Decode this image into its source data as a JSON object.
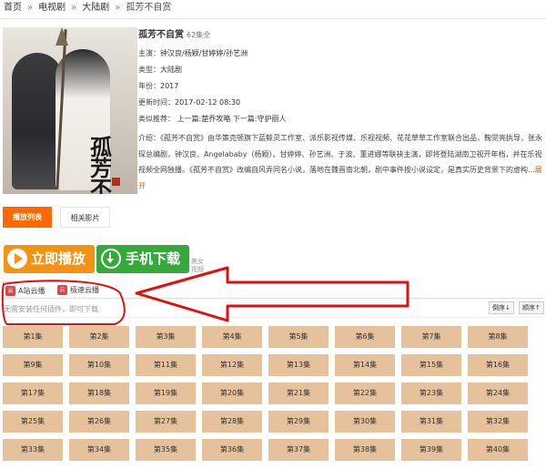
{
  "breadcrumb": {
    "home": "首页",
    "sep": "»",
    "category": "电视剧",
    "subcategory": "大陆剧",
    "current": "孤芳不自赏"
  },
  "poster": {
    "calligraphy": "孤芳不自赏"
  },
  "info": {
    "title": "孤芳不自赏",
    "episodes": "62集全",
    "cast_label": "主演：",
    "cast_value": "钟汉良/杨颖/甘婷婷/孙艺洲",
    "type_label": "类型：",
    "type_value": "大陆剧",
    "year_label": "年份：",
    "year_value": "2017",
    "updated_label": "更新时间：",
    "updated_value": "2017-02-12 08:30",
    "recommend_label": "类似推荐：",
    "prev_label": "上一篇:",
    "prev_link": "楚乔攻略",
    "next_label": "下一篇:",
    "next_link": "守护丽人",
    "intro_label": "介绍：",
    "intro_text": "《孤芳不自赏》由华策克顿旗下蓝鲸灵工作室、派乐影视传媒、乐视视频、花花草草工作室联合出品，鞠觉亮执导，张永琛总编剧，钟汉良、Angelababy（杨颖）、甘婷婷、孙艺洲、于波、董进娜等联袂主演，即将登陆湖南卫视开年档，并在乐视视频全网独播。《孤芳不自赏》改编自风弄同名小说，落地在魏晋南北朝，剧中事件按小说设定，是真实历史背景下的虚构...",
    "more": "展开"
  },
  "tabs": {
    "playlist": "播放列表",
    "related": "相关影片"
  },
  "actions": {
    "play": "立即播放",
    "download": "手机下载",
    "side_ad": "美女视频"
  },
  "sources": {
    "badge": "云",
    "tab1": "A站云播",
    "tab2": "极速云播",
    "note": "无需安装任何插件，即可下载",
    "sort_desc": "倒序↓",
    "sort_asc": "顺序↑"
  },
  "episodes": [
    "第1集",
    "第2集",
    "第3集",
    "第4集",
    "第5集",
    "第6集",
    "第7集",
    "第8集",
    "第9集",
    "第10集",
    "第11集",
    "第12集",
    "第13集",
    "第14集",
    "第15集",
    "第16集",
    "第17集",
    "第18集",
    "第19集",
    "第20集",
    "第21集",
    "第22集",
    "第23集",
    "第24集",
    "第25集",
    "第26集",
    "第27集",
    "第28集",
    "第29集",
    "第30集",
    "第31集",
    "第32集",
    "第33集",
    "第34集",
    "第35集",
    "第36集",
    "第37集",
    "第38集",
    "第39集",
    "第40集"
  ],
  "colors": {
    "accent": "#ff6a00",
    "play": "#f29313",
    "download": "#35a93a",
    "episode_bg": "#e6c29c",
    "annotation": "#e01010"
  }
}
